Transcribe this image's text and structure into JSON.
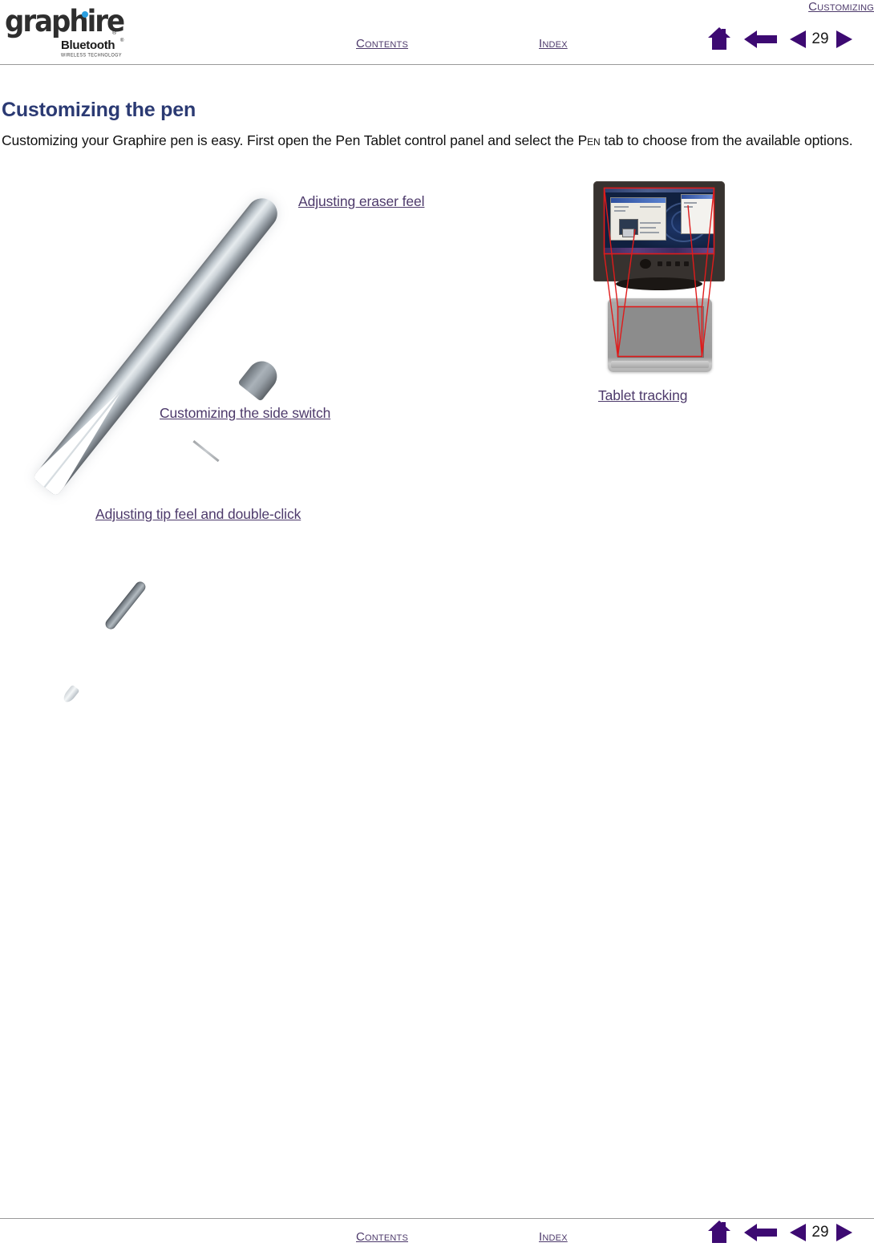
{
  "document": {
    "section_title": "Customizing",
    "page_number": "29"
  },
  "logo": {
    "wordmark": "graphire",
    "registered": "®",
    "bluetooth": "Bluetooth",
    "bluetooth_registered": "®",
    "tagline": "WIRELESS TECHNOLOGY",
    "dot_color": "#2b9fe0"
  },
  "nav": {
    "contents_label": "Contents",
    "index_label": "Index",
    "home_icon": "home-icon",
    "back_icon": "back-arrow-icon",
    "prev_icon": "previous-page-icon",
    "next_icon": "next-page-icon",
    "page_number": "29",
    "accent_color": "#3d0a72",
    "link_color": "#4d3a6b"
  },
  "content": {
    "heading": "Customizing the pen",
    "heading_color": "#2b3a73",
    "body_part1": "Customizing your Graphire pen is easy.  First open the Pen Tablet control panel and select the ",
    "body_smallcaps": "Pen",
    "body_part2": " tab to choose from the available options."
  },
  "figures": {
    "pen": {
      "name": "graphire-pen-illustration",
      "links": [
        {
          "id": "eraser",
          "label": "Adjusting eraser feel"
        },
        {
          "id": "side-switch",
          "label": "Customizing the side switch"
        },
        {
          "id": "tip-feel",
          "label": "Adjusting tip feel and double-click"
        }
      ]
    },
    "tracking": {
      "name": "monitor-tablet-tracking-illustration",
      "link_label": "Tablet tracking",
      "tracking_line_color": "#e01b1b"
    }
  },
  "footer": {
    "contents_label": "Contents",
    "index_label": "Index",
    "page_number": "29"
  }
}
